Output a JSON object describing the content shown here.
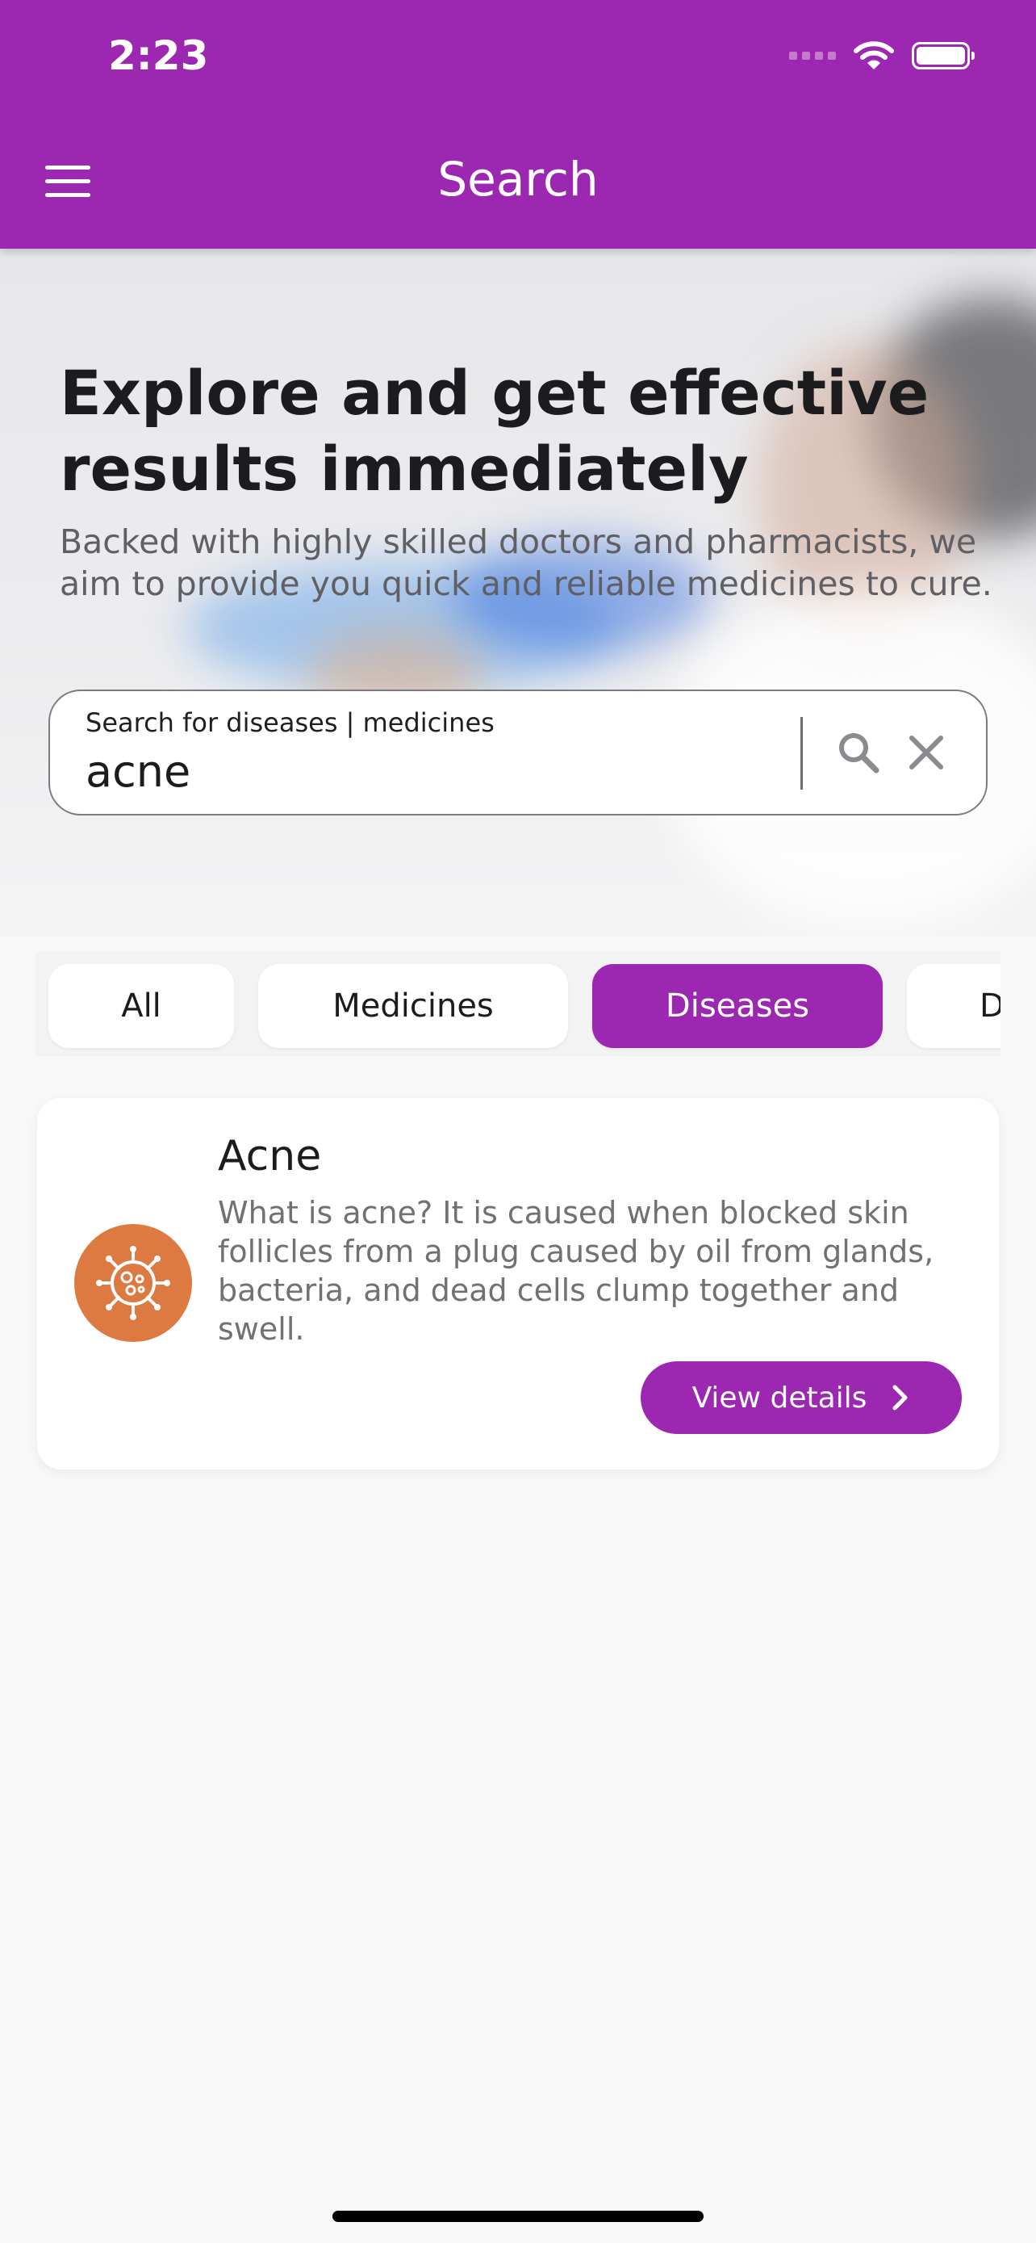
{
  "status_bar": {
    "time": "2:23"
  },
  "app_bar": {
    "title": "Search"
  },
  "hero": {
    "heading": "Explore and get effective results immediately",
    "subtitle": "Backed with highly skilled doctors and pharmacists, we aim to provide you quick and reliable medicines to cure."
  },
  "search": {
    "label": "Search for diseases | medicines",
    "value": "acne"
  },
  "filters": {
    "chips": [
      "All",
      "Medicines",
      "Diseases",
      "D"
    ],
    "selected": "Diseases"
  },
  "results": [
    {
      "title": "Acne",
      "description": "What is acne? It is caused when blocked skin follicles from a plug caused by oil from glands, bacteria, and dead cells clump together and swell.",
      "icon": "virus-icon",
      "button_label": "View details"
    }
  ],
  "colors": {
    "primary": "#9c27b0",
    "result_icon": "#dd7a42",
    "background": "#f8f8f9"
  }
}
